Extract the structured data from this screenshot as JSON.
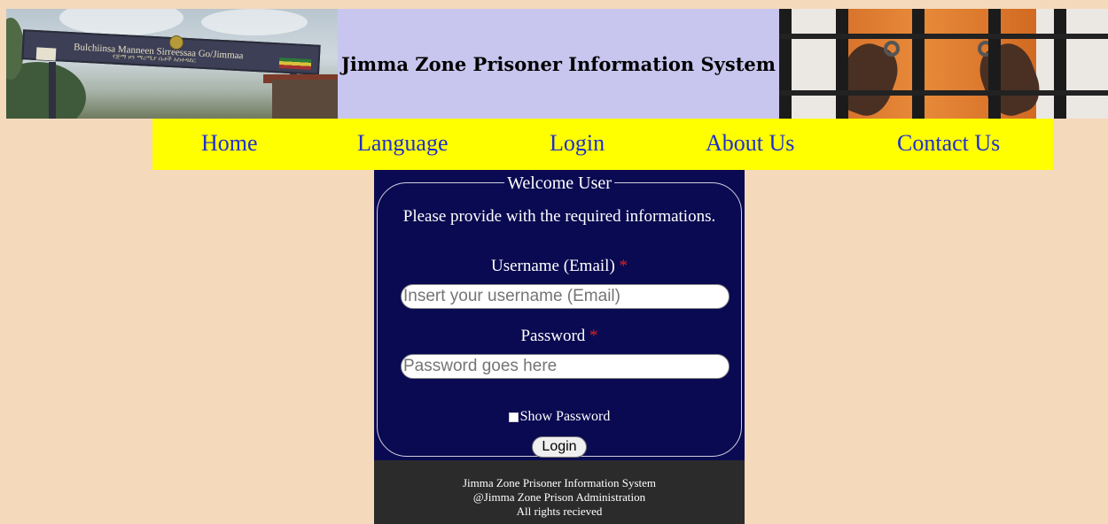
{
  "header": {
    "title": "Jimma Zone Prisoner Information System",
    "gate_sign_text": "Bulchiinsa Manneen Sirreessaa Go/Jimmaa",
    "gate_sign_subtext": "የጅማ ዞን ማረሚያ ቤቶች አስተዳደር"
  },
  "nav": {
    "items": [
      {
        "label": "Home"
      },
      {
        "label": "Language"
      },
      {
        "label": "Login"
      },
      {
        "label": "About Us"
      },
      {
        "label": "Contact Us"
      }
    ],
    "color": "#1f2fd0",
    "background": "#ffff00"
  },
  "login": {
    "legend": "Welcome User",
    "intro": "Please provide with the required informations.",
    "username_label": "Username (Email)",
    "username_placeholder": "Insert your username (Email)",
    "password_label": "Password",
    "password_placeholder": "Password goes here",
    "required_mark": "*",
    "show_password_label": "Show Password",
    "submit_label": "Login",
    "panel_color": "#0a0a52"
  },
  "footer": {
    "line1": "Jimma Zone Prisoner Information System",
    "line2": "@Jimma Zone Prison Administration",
    "line3": "All rights recieved"
  },
  "colors": {
    "page_background": "#f5d9bb",
    "title_background": "#c8c6ee",
    "required": "#e0201c",
    "footer_background": "#2b2b2b"
  }
}
